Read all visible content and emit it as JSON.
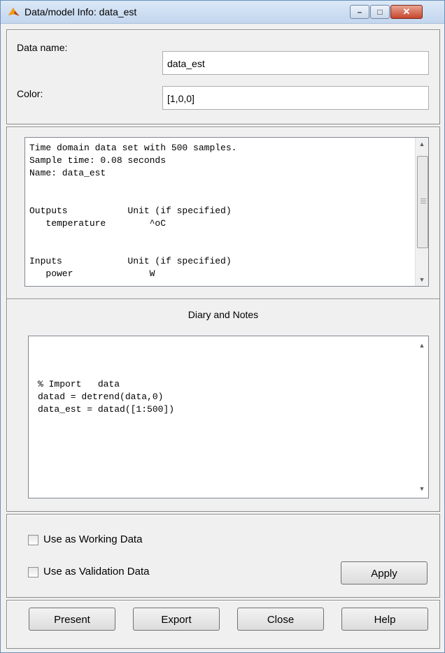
{
  "window": {
    "title": "Data/model Info: data_est",
    "controls": {
      "minimize": "–",
      "maximize": "□",
      "close": "✕"
    },
    "icon": "matlab-icon"
  },
  "fields": {
    "data_name_label": "Data name:",
    "data_name_value": "data_est",
    "color_label": "Color:",
    "color_value": "[1,0,0]"
  },
  "info": {
    "lines": [
      "Time domain data set with 500 samples.",
      "Sample time: 0.08 seconds",
      "Name: data_est",
      "",
      "Outputs           Unit (if specified)",
      "   temperature        ^oC",
      "",
      "Inputs            Unit (if specified)",
      "   power              W"
    ]
  },
  "notes": {
    "header": "Diary and Notes",
    "lines": [
      "",
      "",
      "% Import   data",
      "datad = detrend(data,0)",
      "data_est = datad([1:500])"
    ]
  },
  "options": {
    "working_label": "Use as Working Data",
    "validation_label": "Use as Validation Data",
    "apply_label": "Apply"
  },
  "buttons": {
    "present": "Present",
    "export": "Export",
    "close": "Close",
    "help": "Help"
  },
  "colors": {
    "title_bg": "#c3d6ee",
    "close_button": "#c7452c",
    "panel_bg": "#f0f0f0"
  }
}
